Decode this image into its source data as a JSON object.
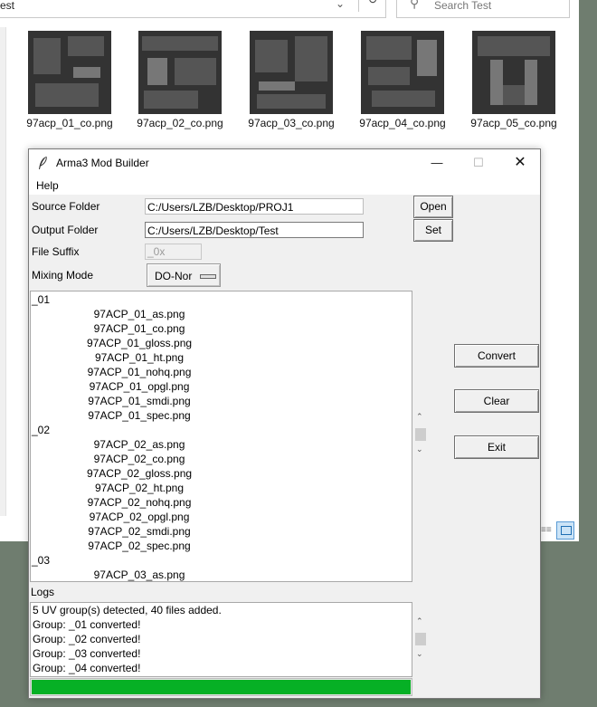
{
  "explorer": {
    "address_text": "est",
    "search_placeholder": "Search Test",
    "thumbnails": [
      {
        "name": "97acp_01_co.png"
      },
      {
        "name": "97acp_02_co.png"
      },
      {
        "name": "97acp_03_co.png"
      },
      {
        "name": "97acp_04_co.png"
      },
      {
        "name": "97acp_05_co.png"
      }
    ]
  },
  "dialog": {
    "title": "Arma3 Mod Builder",
    "menu": {
      "help": "Help"
    },
    "source": {
      "label": "Source Folder",
      "value": "C:/Users/LZB/Desktop/PROJ1",
      "button": "Open"
    },
    "output": {
      "label": "Output Folder",
      "value": "C:/Users/LZB/Desktop/Test",
      "button": "Set"
    },
    "suffix": {
      "label": "File Suffix",
      "placeholder": "_0x"
    },
    "mixing": {
      "label": "Mixing Mode",
      "value": "DO-Nor"
    },
    "files": [
      {
        "text": "_01",
        "type": "group"
      },
      {
        "text": "97ACP_01_as.png",
        "type": "file"
      },
      {
        "text": "97ACP_01_co.png",
        "type": "file"
      },
      {
        "text": "97ACP_01_gloss.png",
        "type": "file"
      },
      {
        "text": "97ACP_01_ht.png",
        "type": "file"
      },
      {
        "text": "97ACP_01_nohq.png",
        "type": "file"
      },
      {
        "text": "97ACP_01_opgl.png",
        "type": "file"
      },
      {
        "text": "97ACP_01_smdi.png",
        "type": "file"
      },
      {
        "text": "97ACP_01_spec.png",
        "type": "file"
      },
      {
        "text": "_02",
        "type": "group"
      },
      {
        "text": "97ACP_02_as.png",
        "type": "file"
      },
      {
        "text": "97ACP_02_co.png",
        "type": "file"
      },
      {
        "text": "97ACP_02_gloss.png",
        "type": "file"
      },
      {
        "text": "97ACP_02_ht.png",
        "type": "file"
      },
      {
        "text": "97ACP_02_nohq.png",
        "type": "file"
      },
      {
        "text": "97ACP_02_opgl.png",
        "type": "file"
      },
      {
        "text": "97ACP_02_smdi.png",
        "type": "file"
      },
      {
        "text": "97ACP_02_spec.png",
        "type": "file"
      },
      {
        "text": "_03",
        "type": "group"
      },
      {
        "text": "97ACP_03_as.png",
        "type": "file"
      }
    ],
    "buttons": {
      "convert": "Convert",
      "clear": "Clear",
      "exit": "Exit"
    },
    "logs": {
      "label": "Logs",
      "lines": [
        "5 UV group(s) detected, 40 files added.",
        "Group: _01 converted!",
        "Group: _02 converted!",
        "Group: _03 converted!",
        "Group: _04 converted!"
      ]
    },
    "progress": 1.0,
    "colors": {
      "progress": "#06b025"
    }
  }
}
